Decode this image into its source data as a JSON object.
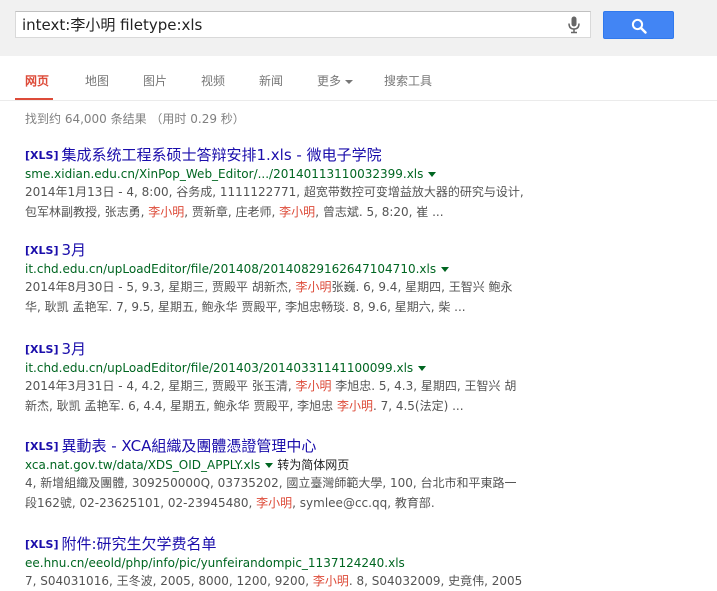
{
  "search": {
    "query": "intext:李小明 filetype:xls"
  },
  "tabs": {
    "web": "网页",
    "maps": "地图",
    "images": "图片",
    "videos": "视频",
    "news": "新闻",
    "more": "更多",
    "tools": "搜索工具"
  },
  "stats": "找到约 64,000 条结果 （用时 0.29 秒）",
  "tag": "[XLS]",
  "results": [
    {
      "title": "集成系统工程系硕士答辩安排1.xls - 微电子学院",
      "url": "sme.xidian.edu.cn/XinPop_Web_Editor/.../20140113110032399.xls",
      "l1": "2014年1月13日 - 4, 8:00, 谷务成, 1111122771, 超宽带数控可变增益放大器的研究与设计,",
      "l2a": "包军林副教授, 张志勇, ",
      "l2hl1": "李小明",
      "l2b": ", 贾新章, 庄老师, ",
      "l2hl2": "李小明",
      "l2c": ", 曾志斌. 5, 8:20, 崔 ..."
    },
    {
      "title": "3月",
      "url": "it.chd.edu.cn/upLoadEditor/file/201408/20140829162647104710.xls",
      "l1a": "2014年8月30日 - 5, 9.3, 星期三, 贾殿平 胡新杰, ",
      "l1hl": "李小明",
      "l1b": "张巍. 6, 9.4, 星期四, 王智兴 鲍永",
      "l2": "华, 耿凯 孟艳军. 7, 9.5, 星期五, 鲍永华 贾殿平, 李旭忠畅琰. 8, 9.6, 星期六, 柴 ..."
    },
    {
      "title": "3月",
      "url": "it.chd.edu.cn/upLoadEditor/file/201403/20140331141100099.xls",
      "l1a": "2014年3月31日 - 4, 4.2, 星期三, 贾殿平 张玉清, ",
      "l1hl": "李小明",
      "l1b": " 李旭忠. 5, 4.3, 星期四, 王智兴 胡",
      "l2a": "新杰, 耿凯 孟艳军. 6, 4.4, 星期五, 鲍永华 贾殿平, 李旭忠 ",
      "l2hl": "李小明",
      "l2b": ". 7, 4.5(法定) ..."
    },
    {
      "title": "異動表 - XCA組織及團體憑證管理中心",
      "url": "xca.nat.gov.tw/data/XDS_OID_APPLY.xls",
      "translate": "转为简体网页",
      "l1": "4, 新增組織及團體, 309250000Q, 03735202, 國立臺灣師範大學, 100, 台北市和平東路一",
      "l2a": "段162號, 02-23625101, 02-23945480, ",
      "l2hl": "李小明",
      "l2b": ", symlee@cc.qq, 教育部."
    },
    {
      "title": "附件:研究生欠学费名单",
      "url": "ee.hnu.cn/eeold/php/info/pic/yunfeirandompic_1137124240.xls",
      "l1a": "7, S04031016, 王冬波, 2005, 8000, 1200, 9200, ",
      "l1hl": "李小明",
      "l1b": ". 8, S04032009, 史竟伟, 2005"
    }
  ]
}
